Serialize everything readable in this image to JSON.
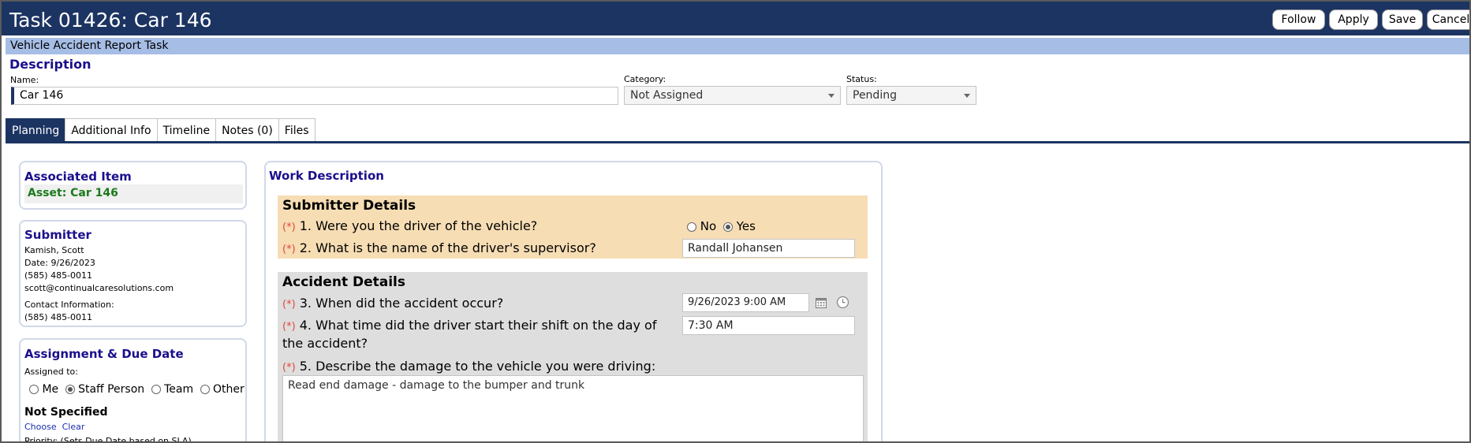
{
  "header": {
    "title": "Task 01426: Car 146",
    "buttons": {
      "follow": "Follow",
      "apply": "Apply",
      "save": "Save",
      "cancel": "Cancel"
    }
  },
  "subheader": "Vehicle Accident Report Task",
  "description": {
    "title": "Description",
    "name_label": "Name:",
    "name_value": "Car 146",
    "category_label": "Category:",
    "category_value": "Not Assigned",
    "status_label": "Status:",
    "status_value": "Pending"
  },
  "tabs": [
    "Planning",
    "Additional Info",
    "Timeline",
    "Notes (0)",
    "Files"
  ],
  "associated_item": {
    "title": "Associated Item",
    "value": "Asset: Car 146"
  },
  "submitter": {
    "title": "Submitter",
    "name": "Kamish, Scott",
    "date": "Date: 9/26/2023",
    "phone": "(585) 485-0011",
    "email": "scott@continualcaresolutions.com",
    "contact_label": "Contact Information:",
    "contact_value": "(585) 485-0011"
  },
  "assignment": {
    "title": "Assignment & Due Date",
    "assigned_to_label": "Assigned to:",
    "options": [
      "Me",
      "Staff Person",
      "Team",
      "Other"
    ],
    "selected": "Staff Person",
    "assignee": "Not Specified",
    "choose_link": "Choose",
    "clear_link": "Clear",
    "priority_label": "Priority: (Sets Due Date based on SLA)"
  },
  "work_description": {
    "title": "Work Description",
    "required_mark": "(*)",
    "submitter_details": {
      "title": "Submitter Details",
      "q1": "1. Were you the driver of the vehicle?",
      "q1_options": [
        "No",
        "Yes"
      ],
      "q1_selected": "Yes",
      "q2": "2. What is the name of the driver's supervisor?",
      "q2_value": "Randall Johansen"
    },
    "accident_details": {
      "title": "Accident Details",
      "q3": "3. When did the accident occur?",
      "q3_value": "9/26/2023 9:00 AM",
      "q4": "4. What time did the driver start their shift on the day of the accident?",
      "q4_value": "7:30 AM",
      "q5": "5. Describe the damage to the vehicle you were driving:",
      "q5_value": "Read end damage - damage to the bumper and trunk"
    }
  },
  "icons": {
    "calendar": "calendar-icon",
    "clock": "clock-icon",
    "dropdown": "chevron-down-icon"
  },
  "colors": {
    "header_bg": "#1c3462",
    "subheader_bg": "#a6bde5",
    "section_title": "#1a0f8c",
    "required": "#e0463c",
    "asset_link": "#1b7a1b"
  }
}
